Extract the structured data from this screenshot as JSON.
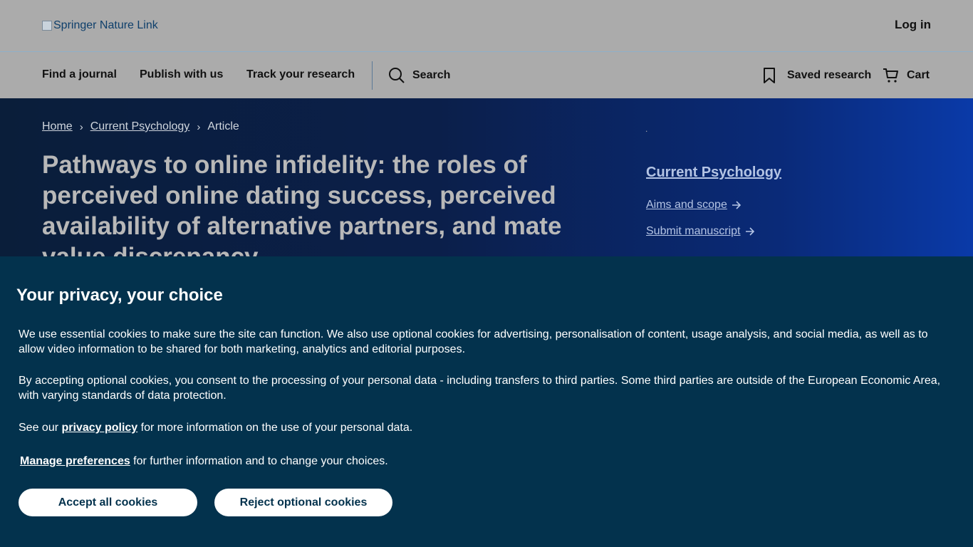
{
  "header": {
    "logo_alt": "Springer Nature Link",
    "login": "Log in"
  },
  "nav": {
    "find_journal": "Find a journal",
    "publish": "Publish with us",
    "track": "Track your research",
    "search": "Search",
    "saved": "Saved research",
    "cart": "Cart"
  },
  "breadcrumb": {
    "home": "Home",
    "journal": "Current Psychology",
    "article": "Article"
  },
  "article": {
    "title": "Pathways to online infidelity: the roles of perceived online dating success, perceived availability of alternative partners, and mate value discrepancy"
  },
  "journal_panel": {
    "dot": ".",
    "name": "Current Psychology",
    "aims": "Aims and scope",
    "submit": "Submit manuscript"
  },
  "cookie": {
    "heading": "Your privacy, your choice",
    "p1": "We use essential cookies to make sure the site can function. We also use optional cookies for advertising, personalisation of content, usage analysis, and social media, as well as to allow video information to be shared for both marketing, analytics and editorial purposes.",
    "p2": "By accepting optional cookies, you consent to the processing of your personal data - including transfers to third parties. Some third parties are outside of the European Economic Area, with varying standards of data protection.",
    "p3_pre": "See our ",
    "p3_link": "privacy policy",
    "p3_post": " for more information on the use of your personal data.",
    "p4_link": "Manage preferences",
    "p4_post": " for further information and to change your choices.",
    "accept": "Accept all cookies",
    "reject": "Reject optional cookies"
  }
}
